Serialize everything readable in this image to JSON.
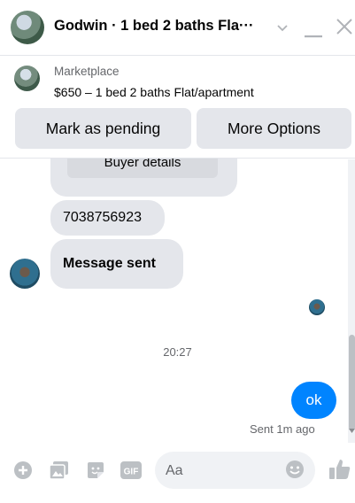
{
  "header": {
    "title": "Godwin · 1 bed 2 baths Fla···",
    "icons": [
      "chevron-down-icon",
      "minimize-icon",
      "close-icon"
    ]
  },
  "marketplace": {
    "label": "Marketplace",
    "item": "$650 – 1 bed 2 baths Flat/apartment",
    "pending_button": "Mark as pending",
    "options_button": "More Options"
  },
  "messages": {
    "template_button": "Buyer details",
    "phone": "7038756923",
    "message_sent": "Message sent",
    "timestamp": "20:27",
    "outgoing": "ok",
    "status": "Sent 1m ago"
  },
  "composer": {
    "placeholder": "Aa",
    "gif_label": "GIF",
    "icons": [
      "plus-icon",
      "image-icon",
      "sticker-icon",
      "gif-icon",
      "emoji-icon",
      "thumbs-up-icon"
    ]
  },
  "colors": {
    "accent": "#0084ff",
    "bubble_gray": "#e4e6eb",
    "icon_gray": "#bcc0c4"
  }
}
